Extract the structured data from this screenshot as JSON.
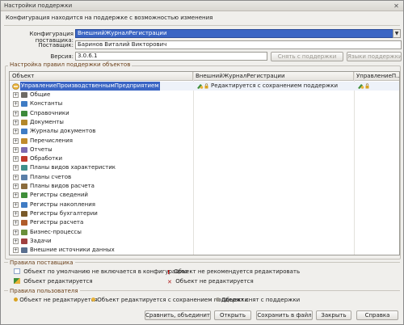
{
  "window": {
    "title": "Настройки поддержки",
    "close_glyph": "✕"
  },
  "info_text": "Конфигурация находится на поддержке с возможностью изменения",
  "supplier_config": {
    "label": "Конфигурация поставщика:",
    "value": "ВнешнийЖурналРегистрации",
    "dropdown_glyph": "▼"
  },
  "supplier": {
    "label": "Поставщик:",
    "value": "Баринов Виталий Викторович"
  },
  "version": {
    "label": "Версия:",
    "value": "3.0.6.1"
  },
  "top_buttons": {
    "remove_support": "Снять с поддержки",
    "support_languages": "Языки поддержки"
  },
  "rules_group_title": "Настройка правил поддержки объектов",
  "table": {
    "columns": [
      "Объект",
      "ВнешнийЖурналРегистрации",
      "УправлениеП..."
    ],
    "first_row": {
      "object": "УправлениеПроизводственнымПредприятием",
      "vendor_rule": "Редактируется с сохранением поддержки",
      "third_icon": "edit-support-icon"
    },
    "rows": [
      {
        "label": "Общие",
        "icon": "general-icon"
      },
      {
        "label": "Константы",
        "icon": "constants-icon"
      },
      {
        "label": "Справочники",
        "icon": "catalogs-icon"
      },
      {
        "label": "Документы",
        "icon": "documents-icon"
      },
      {
        "label": "Журналы документов",
        "icon": "journals-icon"
      },
      {
        "label": "Перечисления",
        "icon": "enums-icon"
      },
      {
        "label": "Отчеты",
        "icon": "reports-icon"
      },
      {
        "label": "Обработки",
        "icon": "processing-icon"
      },
      {
        "label": "Планы видов характеристик",
        "icon": "chart-types-icon"
      },
      {
        "label": "Планы счетов",
        "icon": "chart-accounts-icon"
      },
      {
        "label": "Планы видов расчета",
        "icon": "calc-types-icon"
      },
      {
        "label": "Регистры сведений",
        "icon": "info-registers-icon"
      },
      {
        "label": "Регистры накопления",
        "icon": "accum-registers-icon"
      },
      {
        "label": "Регистры бухгалтерии",
        "icon": "acc-registers-icon"
      },
      {
        "label": "Регистры расчета",
        "icon": "calc-registers-icon"
      },
      {
        "label": "Бизнес-процессы",
        "icon": "business-processes-icon"
      },
      {
        "label": "Задачи",
        "icon": "tasks-icon"
      },
      {
        "label": "Внешние источники данных",
        "icon": "external-sources-icon"
      }
    ]
  },
  "vendor_rules": {
    "title": "Правила поставщика",
    "items": [
      "Объект по умолчанию не включается в конфигурацию",
      "Объект не рекомендуется редактировать",
      "Объект редактируется",
      "Объект не редактируется"
    ]
  },
  "user_rules": {
    "title": "Правила пользователя",
    "items": [
      "Объект не редактируется",
      "Объект редактируется с сохранением поддержки",
      "Объект снят с поддержки"
    ]
  },
  "bottom_buttons": {
    "compare": "Сравнить, объединить",
    "open": "Открыть",
    "save": "Сохранить в файл",
    "close": "Закрыть",
    "help": "Справка"
  },
  "colors": {
    "selection": "#3a65c4",
    "group_title": "#6a3f18"
  }
}
